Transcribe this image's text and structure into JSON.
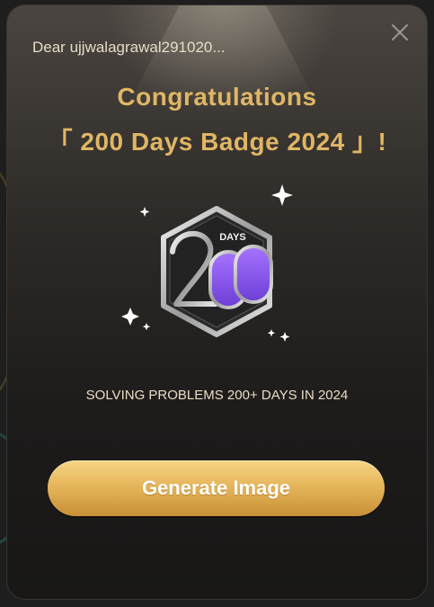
{
  "modal": {
    "greeting": "Dear ujjwalagrawal291020...",
    "title_line1": "Congratulations",
    "title_line2": "「 200 Days Badge 2024 」!",
    "badge": {
      "label": "DAYS",
      "number": "200",
      "icon": "200-days-badge-icon",
      "accent_color": "#8a52e8"
    },
    "description": "SOLVING PROBLEMS 200+ DAYS IN 2024",
    "generate_button_label": "Generate Image",
    "close_icon": "close-icon"
  },
  "colors": {
    "title_gold": "#e0b665",
    "button_gold_top": "#f6d585",
    "button_gold_bottom": "#c89036"
  }
}
